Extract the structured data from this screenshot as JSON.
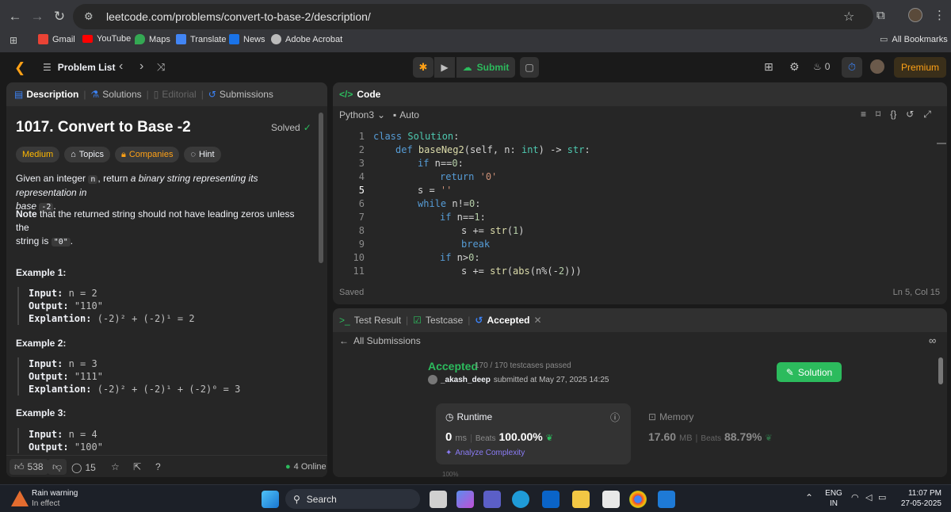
{
  "browser": {
    "url": "leetcode.com/problems/convert-to-base-2/description/",
    "bookmarks": [
      "Gmail",
      "YouTube",
      "Maps",
      "Translate",
      "News",
      "Adobe Acrobat"
    ],
    "all_bookmarks": "All Bookmarks"
  },
  "header": {
    "problem_list": "Problem List",
    "submit": "Submit",
    "streak": "0",
    "premium": "Premium"
  },
  "left": {
    "tabs": {
      "description": "Description",
      "solutions": "Solutions",
      "editorial": "Editorial",
      "submissions": "Submissions"
    },
    "title": "1017. Convert to Base -2",
    "solved": "Solved",
    "tags": {
      "difficulty": "Medium",
      "topics": "Topics",
      "companies": "Companies",
      "hint": "Hint"
    },
    "desc": {
      "p1a": "Given an integer ",
      "n": "n",
      "p1b": ", return ",
      "p1c": "a binary string representing its representation in",
      "p1d": "base ",
      "base": "-2",
      "p1e": ".",
      "note_bold": "Note",
      "note_rest": " that the returned string should not have leading zeros unless the",
      "note_rest2": "string is ",
      "zero": "\"0\"",
      "note_end": "."
    },
    "examples": [
      {
        "title": "Example 1:",
        "input_label": "Input:",
        "input": "n = 2",
        "output_label": "Output:",
        "output": "\"110\"",
        "expl_label": "Explantion:",
        "expl": "(-2)² + (-2)¹ = 2"
      },
      {
        "title": "Example 2:",
        "input_label": "Input:",
        "input": "n = 3",
        "output_label": "Output:",
        "output": "\"111\"",
        "expl_label": "Explantion:",
        "expl": "(-2)² + (-2)¹ + (-2)⁰ = 3"
      },
      {
        "title": "Example 3:",
        "input_label": "Input:",
        "input": "n = 4",
        "output_label": "Output:",
        "output": "\"100\""
      }
    ],
    "footer": {
      "likes": "538",
      "comments": "15",
      "online": "4 Online"
    }
  },
  "code": {
    "tab": "Code",
    "language": "Python3",
    "auto": "Auto",
    "saved": "Saved",
    "cursor": "Ln 5, Col 15",
    "lines": [
      "1",
      "2",
      "3",
      "4",
      "5",
      "6",
      "7",
      "8",
      "9",
      "10",
      "11"
    ]
  },
  "result": {
    "tabs": {
      "test_result": "Test Result",
      "testcase": "Testcase",
      "accepted": "Accepted"
    },
    "all_submissions": "All Submissions",
    "status": "Accepted",
    "testcases": "170 / 170 testcases passed",
    "user": "_akash_deep",
    "submitted": "submitted at May 27, 2025 14:25",
    "solution_btn": "Solution",
    "runtime": {
      "label": "Runtime",
      "value": "0",
      "unit": "ms",
      "beats_label": "Beats",
      "beats": "100.00%",
      "analyze": "Analyze Complexity"
    },
    "memory": {
      "label": "Memory",
      "value": "17.60",
      "unit": "MB",
      "beats_label": "Beats",
      "beats": "88.79%"
    },
    "axis": "100%"
  },
  "taskbar": {
    "weather_title": "Rain warning",
    "weather_sub": "In effect",
    "search": "Search",
    "lang1": "ENG",
    "lang2": "IN",
    "time": "11:07 PM",
    "date": "27-05-2025"
  },
  "colors": {
    "accent_green": "#2cbb5d",
    "medium": "#ffb800",
    "premium": "#ffa116"
  }
}
